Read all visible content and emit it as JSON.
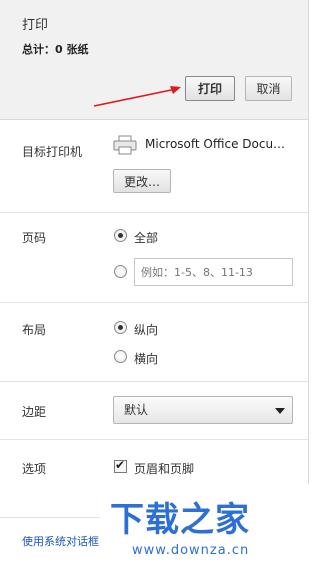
{
  "header": {
    "title": "打印",
    "total": "总计：0 张纸",
    "print_label": "打印",
    "cancel_label": "取消"
  },
  "destination": {
    "label": "目标打印机",
    "printer_name": "Microsoft Office Docu…",
    "change_label": "更改…"
  },
  "pages": {
    "label": "页码",
    "all_label": "全部",
    "all_selected": true,
    "custom_placeholder": "例如：1-5、8、11-13"
  },
  "layout": {
    "label": "布局",
    "portrait_label": "纵向",
    "portrait_selected": true,
    "landscape_label": "横向"
  },
  "margins": {
    "label": "边距",
    "selected": "默认"
  },
  "options": {
    "label": "选项",
    "header_footer_label": "页眉和页脚",
    "header_footer_checked": true
  },
  "system_dialog_link": "使用系统对话框",
  "watermark": {
    "main": "下载之家",
    "sub": "www.downza.cn"
  },
  "colors": {
    "arrow": "#e0191d",
    "link": "#1a57b8",
    "watermark": "#2e6fd4"
  }
}
